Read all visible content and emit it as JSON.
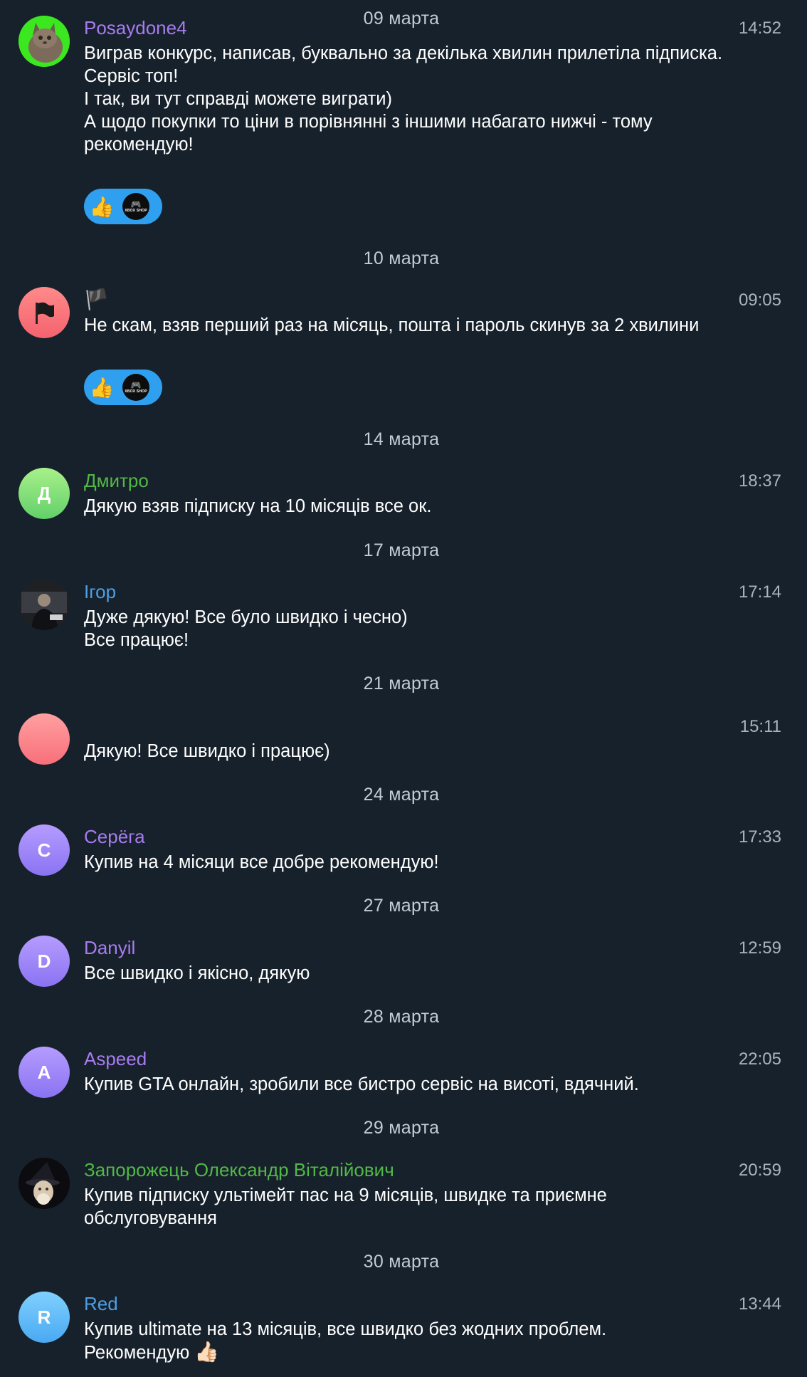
{
  "colors": {
    "background": "#17212b",
    "text": "#ffffff",
    "secondary_text": "#aab4bf",
    "name_purple": "#a77cf0",
    "name_green": "#52b847",
    "name_blue": "#4d9fe6",
    "reaction_bg": "#2fa0f0"
  },
  "dates": [
    "09 марта",
    "10 марта",
    "14 марта",
    "17 марта",
    "21 марта",
    "24 марта",
    "27 марта",
    "28 марта",
    "29 марта",
    "30 марта"
  ],
  "messages": [
    {
      "author": "Posaydone4",
      "time": "14:52",
      "text": "Виграв конкурс, написав, буквально за декілька хвилин прилетіла підписка.\nСервіс топ!\nІ так, ви тут справді можете виграти)\nА щодо покупки то ціни в порівнянні з іншими набагато нижчі - тому рекомендую!",
      "avatar": "cat-photo",
      "reactions": {
        "emoji": "👍",
        "logo_glyph": "🎮",
        "logo_text": "XBOX SHOP"
      }
    },
    {
      "author": "🏴",
      "time": "09:05",
      "text": "Не скам, взяв перший раз на місяць, пошта і пароль скинув за 2 хвилини",
      "avatar": "black-flag",
      "reactions": {
        "emoji": "👍",
        "logo_glyph": "🎮",
        "logo_text": "XBOX SHOP"
      }
    },
    {
      "author": "Дмитро",
      "time": "18:37",
      "text": "Дякую взяв підписку на 10 місяців все ок.",
      "avatar_letter": "Д"
    },
    {
      "author": "Ігор",
      "time": "17:14",
      "text": "Дуже дякую! Все було швидко і чесно)\nВсе працює!",
      "avatar": "person-photo"
    },
    {
      "author": "",
      "time": "15:11",
      "text": "Дякую! Все швидко і працює)",
      "avatar": "blank-pink"
    },
    {
      "author": "Серёга",
      "time": "17:33",
      "text": "Купив на 4 місяци все добре рекомендую!",
      "avatar_letter": "С"
    },
    {
      "author": "Danyil",
      "time": "12:59",
      "text": "Все швидко і якісно, дякую",
      "avatar_letter": "D"
    },
    {
      "author": "Aspeed",
      "time": "22:05",
      "text": "Купив GTA онлайн, зробили все бистро сервіс на висоті, вдячний.",
      "avatar_letter": "A"
    },
    {
      "author": "Запорожець Олександр Віталійович",
      "time": "20:59",
      "text": "Купив підписку ультімейт пас на 9 місяців, швидке та приємне обслуговування",
      "avatar": "wizard-photo"
    },
    {
      "author": "Red",
      "time": "13:44",
      "text": "Купив ultimate на 13 місяців, все швидко без жодних проблем.\nРекомендую",
      "text_suffix_emoji": "👍🏻",
      "avatar_letter": "R"
    }
  ]
}
